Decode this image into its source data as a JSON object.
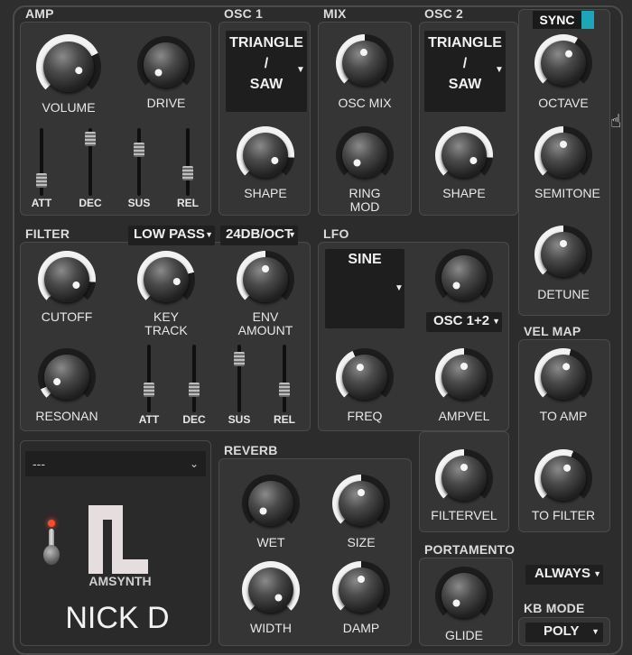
{
  "sections": {
    "amp": "AMP",
    "osc1": "OSC 1",
    "mix": "MIX",
    "osc2": "OSC 2",
    "filter": "FILTER",
    "lfo": "LFO",
    "vel_map": "VEL MAP",
    "reverb": "REVERB",
    "portamento": "PORTAMENTO",
    "kb_mode": "KB MODE"
  },
  "amp": {
    "volume": "VOLUME",
    "drive": "DRIVE",
    "att": "ATT",
    "dec": "DEC",
    "sus": "SUS",
    "rel": "REL"
  },
  "osc1": {
    "waveform": "TRIANGLE /\nSAW",
    "shape": "SHAPE"
  },
  "mix": {
    "osc_mix": "OSC MIX",
    "ring_mod": "RING\nMOD"
  },
  "osc2": {
    "waveform": "TRIANGLE /\nSAW",
    "shape": "SHAPE",
    "sync": "SYNC",
    "octave": "OCTAVE",
    "semitone": "SEMITONE",
    "detune": "DETUNE"
  },
  "filter": {
    "type": "LOW PASS",
    "slope": "24DB/OCT",
    "cutoff": "CUTOFF",
    "key_track": "KEY\nTRACK",
    "env_amount": "ENV\nAMOUNT",
    "resonance": "RESONAN",
    "att": "ATT",
    "dec": "DEC",
    "sus": "SUS",
    "rel": "REL"
  },
  "lfo": {
    "waveform": "SINE",
    "target": "OSC 1+2",
    "freq": "FREQ",
    "ampvel": "AMPVEL",
    "filtervel": "FILTERVEL"
  },
  "vel_map": {
    "to_amp": "TO AMP",
    "to_filter": "TO FILTER"
  },
  "reverb": {
    "wet": "WET",
    "size": "SIZE",
    "width": "WIDTH",
    "damp": "DAMP"
  },
  "portamento": {
    "mode": "ALWAYS",
    "glide": "GLIDE"
  },
  "kb_mode": {
    "mode": "POLY"
  },
  "preset": {
    "selected": "---"
  },
  "branding": {
    "logo_text": "AMSYNTH",
    "author": "NICK D"
  },
  "colors": {
    "sync_accent": "#1ca7b8",
    "background": "#2e2e2e",
    "panel": "#353535"
  },
  "icons": {
    "dropdown": "chevron-down-icon",
    "toggle": "power-toggle-icon"
  }
}
